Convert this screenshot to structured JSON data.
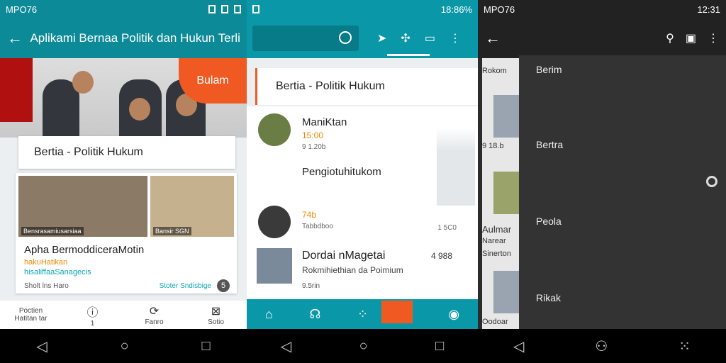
{
  "screen1": {
    "status": {
      "left": "MPO76",
      "right": ""
    },
    "appbar": {
      "back": "←",
      "title": "Aplikami Bernaa Politik dan Hukun Terlini"
    },
    "badge": "Bulam",
    "section_title": "Bertia - Politik Hukum",
    "news_card": {
      "photo_caption_1": "Bensrasamiusarsiaa",
      "photo_caption_2": "Bansir SGN",
      "title": "Apha BermoddiceraMotin",
      "sub1": "hakuHatikan",
      "sub2": "hisaliffaaSanagecis",
      "footer": "Sholt lns Haro",
      "tag": "Stoter Sndisbige",
      "count": "5"
    },
    "bottom_row": [
      {
        "label": "Poctien",
        "sub": "Hatitan tar"
      },
      {
        "icon": "ⓘ",
        "sub": "1"
      },
      {
        "icon": "⟳",
        "sub": "Fanro"
      },
      {
        "icon": "⊠",
        "sub": "Sotio"
      }
    ]
  },
  "screen2": {
    "status": {
      "right": "18:86%"
    },
    "section_title": "Bertia - Politik Hukum",
    "list": [
      {
        "title": "ManiKtan",
        "sub": "15:00",
        "meta": "9 1.20b"
      },
      {
        "title": "Pengiotuhitukom",
        "sub": "",
        "meta": ""
      },
      {
        "title": "74b",
        "sub": "",
        "meta": "Tabbdboo",
        "right": "1 5C0"
      }
    ],
    "card": {
      "title": "Dordai nMagetai",
      "count": "4 988",
      "sub": "Rokmihiethian da Poimium",
      "footer": "9.5rin"
    }
  },
  "screen3": {
    "status": {
      "left": "MPO76",
      "right": "12:31"
    },
    "peek": [
      "Rokom",
      "9 18.b",
      "Aulmar",
      "Narear",
      "Sinerton",
      "Oodoar"
    ],
    "drawer_items": [
      "Berim",
      "Bertra",
      "Peola",
      "Rikak"
    ]
  }
}
